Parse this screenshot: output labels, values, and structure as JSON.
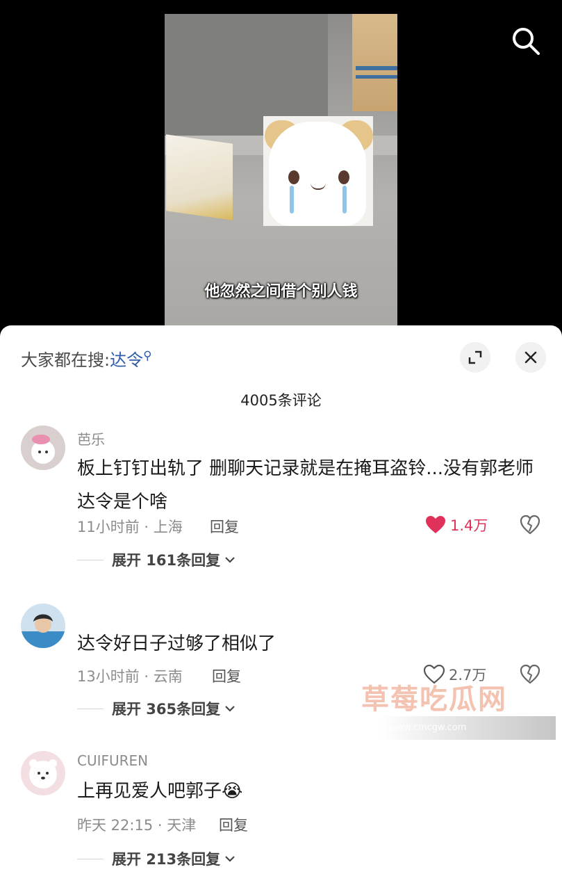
{
  "video": {
    "subtitle": "他忽然之间借个别人钱"
  },
  "sheet": {
    "hot_search_label": "大家都在搜:",
    "hot_search_keyword": "达令",
    "comment_count": "4005条评论"
  },
  "comments": [
    {
      "user": "芭乐",
      "content": "板上钉钉出轨了 删聊天记录就是在掩耳盗铃...没有郭老师达令是个啥",
      "meta": "11小时前 · 上海",
      "reply": "回复",
      "likes": "1.4万",
      "liked": true,
      "expand": "展开 161条回复"
    },
    {
      "user": "",
      "content": "达令好日子过够了相似了",
      "meta": "13小时前 · 云南",
      "reply": "回复",
      "likes": "2.7万",
      "liked": false,
      "expand": "展开 365条回复"
    },
    {
      "user": "CUIFUREN",
      "content": "上再见爱人吧郭子😭",
      "meta": "昨天 22:15 · 天津",
      "reply": "回复",
      "likes": "",
      "liked": false,
      "expand": "展开 213条回复"
    }
  ],
  "watermark": {
    "title": "草莓吃瓜网",
    "url": "www.cmcgw.com"
  },
  "colors": {
    "like_active": "#e0315b",
    "keyword": "#2e5da8"
  }
}
